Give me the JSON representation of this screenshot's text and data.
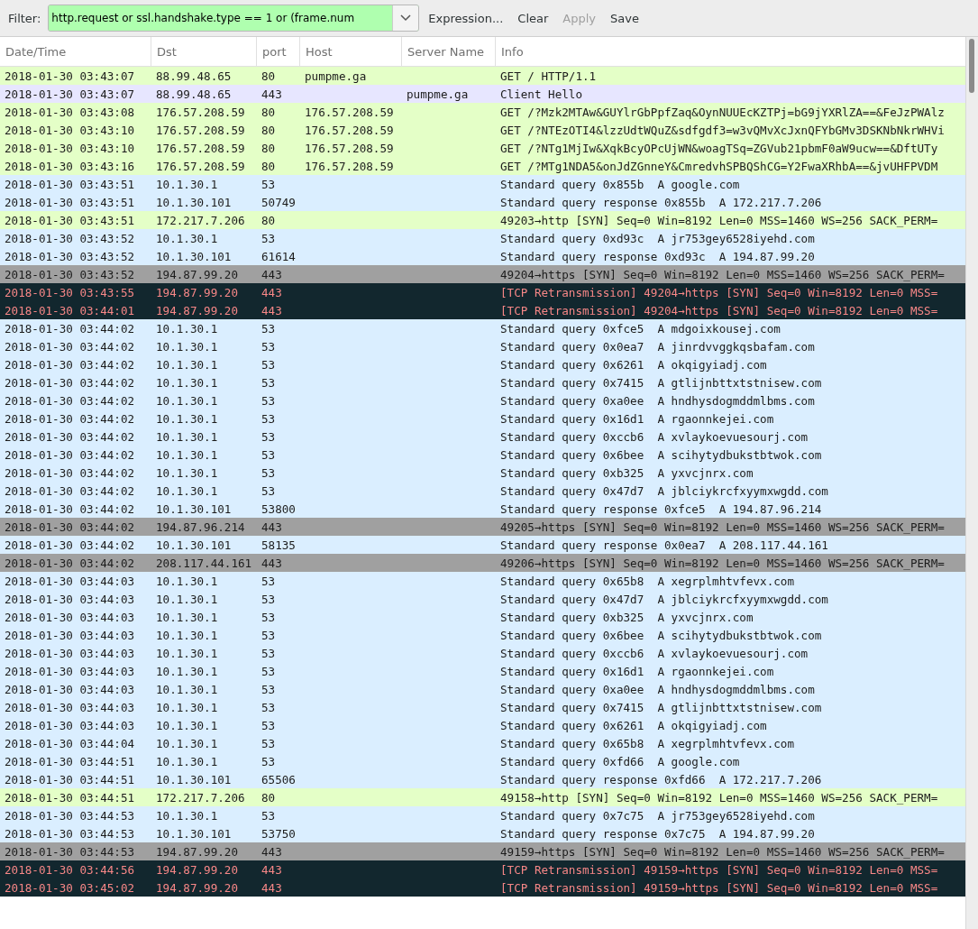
{
  "filter": {
    "label": "Filter:",
    "value": "http.request or ssl.handshake.type == 1 or (frame.num",
    "buttons": [
      {
        "label": "Expression...",
        "disabled": false
      },
      {
        "label": "Clear",
        "disabled": false
      },
      {
        "label": "Apply",
        "disabled": true
      },
      {
        "label": "Save",
        "disabled": false
      }
    ]
  },
  "table": {
    "columns": [
      "Date/Time",
      "Dst",
      "port",
      "Host",
      "Server Name",
      "Info"
    ],
    "rows": [
      {
        "kind": "http",
        "time": "2018-01-30 03:43:07",
        "dst": "88.99.48.65",
        "port": "80",
        "host": "pumpme.ga",
        "info": "GET / HTTP/1.1"
      },
      {
        "kind": "tls",
        "time": "2018-01-30 03:43:07",
        "dst": "88.99.48.65",
        "port": "443",
        "server": "pumpme.ga",
        "info": "Client Hello"
      },
      {
        "kind": "http",
        "time": "2018-01-30 03:43:08",
        "dst": "176.57.208.59",
        "port": "80",
        "host": "176.57.208.59",
        "info": "GET /?Mzk2MTAw&GUYlrGbPpfZaq&OynNUUEcKZTPj=bG9jYXRlZA==&FeJzPWAlz"
      },
      {
        "kind": "http",
        "time": "2018-01-30 03:43:10",
        "dst": "176.57.208.59",
        "port": "80",
        "host": "176.57.208.59",
        "info": "GET /?NTEzOTI4&lzzUdtWQuZ&sdfgdf3=w3vQMvXcJxnQFYbGMv3DSKNbNkrWHVi"
      },
      {
        "kind": "http",
        "time": "2018-01-30 03:43:10",
        "dst": "176.57.208.59",
        "port": "80",
        "host": "176.57.208.59",
        "info": "GET /?NTg1MjIw&XqkBcyOPcUjWN&woagTSq=ZGVub21pbmF0aW9ucw==&DftUTy"
      },
      {
        "kind": "http",
        "time": "2018-01-30 03:43:16",
        "dst": "176.57.208.59",
        "port": "80",
        "host": "176.57.208.59",
        "info": "GET /?MTg1NDA5&onJdZGnneY&CmredvhSPBQShCG=Y2FwaXRhbA==&jvUHFPVDM"
      },
      {
        "kind": "dns",
        "time": "2018-01-30 03:43:51",
        "dst": "10.1.30.1",
        "port": "53",
        "info": "Standard query 0x855b  A google.com"
      },
      {
        "kind": "dns",
        "time": "2018-01-30 03:43:51",
        "dst": "10.1.30.101",
        "port": "50749",
        "info": "Standard query response 0x855b  A 172.217.7.206"
      },
      {
        "kind": "http",
        "time": "2018-01-30 03:43:51",
        "dst": "172.217.7.206",
        "port": "80",
        "info": "49203→http [SYN] Seq=0 Win=8192 Len=0 MSS=1460 WS=256 SACK_PERM="
      },
      {
        "kind": "dns",
        "time": "2018-01-30 03:43:52",
        "dst": "10.1.30.1",
        "port": "53",
        "info": "Standard query 0xd93c  A jr753gey6528iyehd.com"
      },
      {
        "kind": "dns",
        "time": "2018-01-30 03:43:52",
        "dst": "10.1.30.101",
        "port": "61614",
        "info": "Standard query response 0xd93c  A 194.87.99.20"
      },
      {
        "kind": "syn",
        "time": "2018-01-30 03:43:52",
        "dst": "194.87.99.20",
        "port": "443",
        "info": "49204→https [SYN] Seq=0 Win=8192 Len=0 MSS=1460 WS=256 SACK_PERM="
      },
      {
        "kind": "retrans",
        "time": "2018-01-30 03:43:55",
        "dst": "194.87.99.20",
        "port": "443",
        "info": "[TCP Retransmission] 49204→https [SYN] Seq=0 Win=8192 Len=0 MSS="
      },
      {
        "kind": "retrans",
        "time": "2018-01-30 03:44:01",
        "dst": "194.87.99.20",
        "port": "443",
        "info": "[TCP Retransmission] 49204→https [SYN] Seq=0 Win=8192 Len=0 MSS="
      },
      {
        "kind": "dns",
        "time": "2018-01-30 03:44:02",
        "dst": "10.1.30.1",
        "port": "53",
        "info": "Standard query 0xfce5  A mdgoixkousej.com"
      },
      {
        "kind": "dns",
        "time": "2018-01-30 03:44:02",
        "dst": "10.1.30.1",
        "port": "53",
        "info": "Standard query 0x0ea7  A jinrdvvggkqsbafam.com"
      },
      {
        "kind": "dns",
        "time": "2018-01-30 03:44:02",
        "dst": "10.1.30.1",
        "port": "53",
        "info": "Standard query 0x6261  A okqigyiadj.com"
      },
      {
        "kind": "dns",
        "time": "2018-01-30 03:44:02",
        "dst": "10.1.30.1",
        "port": "53",
        "info": "Standard query 0x7415  A gtlijnbttxtstnisew.com"
      },
      {
        "kind": "dns",
        "time": "2018-01-30 03:44:02",
        "dst": "10.1.30.1",
        "port": "53",
        "info": "Standard query 0xa0ee  A hndhysdogmddmlbms.com"
      },
      {
        "kind": "dns",
        "time": "2018-01-30 03:44:02",
        "dst": "10.1.30.1",
        "port": "53",
        "info": "Standard query 0x16d1  A rgaonnkejei.com"
      },
      {
        "kind": "dns",
        "time": "2018-01-30 03:44:02",
        "dst": "10.1.30.1",
        "port": "53",
        "info": "Standard query 0xccb6  A xvlaykoevuesourj.com"
      },
      {
        "kind": "dns",
        "time": "2018-01-30 03:44:02",
        "dst": "10.1.30.1",
        "port": "53",
        "info": "Standard query 0x6bee  A scihytydbukstbtwok.com"
      },
      {
        "kind": "dns",
        "time": "2018-01-30 03:44:02",
        "dst": "10.1.30.1",
        "port": "53",
        "info": "Standard query 0xb325  A yxvcjnrx.com"
      },
      {
        "kind": "dns",
        "time": "2018-01-30 03:44:02",
        "dst": "10.1.30.1",
        "port": "53",
        "info": "Standard query 0x47d7  A jblciykrcfxyymxwgdd.com"
      },
      {
        "kind": "dns",
        "time": "2018-01-30 03:44:02",
        "dst": "10.1.30.101",
        "port": "53800",
        "info": "Standard query response 0xfce5  A 194.87.96.214"
      },
      {
        "kind": "syn",
        "time": "2018-01-30 03:44:02",
        "dst": "194.87.96.214",
        "port": "443",
        "info": "49205→https [SYN] Seq=0 Win=8192 Len=0 MSS=1460 WS=256 SACK_PERM="
      },
      {
        "kind": "dns",
        "time": "2018-01-30 03:44:02",
        "dst": "10.1.30.101",
        "port": "58135",
        "info": "Standard query response 0x0ea7  A 208.117.44.161"
      },
      {
        "kind": "syn",
        "time": "2018-01-30 03:44:02",
        "dst": "208.117.44.161",
        "port": "443",
        "info": "49206→https [SYN] Seq=0 Win=8192 Len=0 MSS=1460 WS=256 SACK_PERM="
      },
      {
        "kind": "dns",
        "time": "2018-01-30 03:44:03",
        "dst": "10.1.30.1",
        "port": "53",
        "info": "Standard query 0x65b8  A xegrplmhtvfevx.com"
      },
      {
        "kind": "dns",
        "time": "2018-01-30 03:44:03",
        "dst": "10.1.30.1",
        "port": "53",
        "info": "Standard query 0x47d7  A jblciykrcfxyymxwgdd.com"
      },
      {
        "kind": "dns",
        "time": "2018-01-30 03:44:03",
        "dst": "10.1.30.1",
        "port": "53",
        "info": "Standard query 0xb325  A yxvcjnrx.com"
      },
      {
        "kind": "dns",
        "time": "2018-01-30 03:44:03",
        "dst": "10.1.30.1",
        "port": "53",
        "info": "Standard query 0x6bee  A scihytydbukstbtwok.com"
      },
      {
        "kind": "dns",
        "time": "2018-01-30 03:44:03",
        "dst": "10.1.30.1",
        "port": "53",
        "info": "Standard query 0xccb6  A xvlaykoevuesourj.com"
      },
      {
        "kind": "dns",
        "time": "2018-01-30 03:44:03",
        "dst": "10.1.30.1",
        "port": "53",
        "info": "Standard query 0x16d1  A rgaonnkejei.com"
      },
      {
        "kind": "dns",
        "time": "2018-01-30 03:44:03",
        "dst": "10.1.30.1",
        "port": "53",
        "info": "Standard query 0xa0ee  A hndhysdogmddmlbms.com"
      },
      {
        "kind": "dns",
        "time": "2018-01-30 03:44:03",
        "dst": "10.1.30.1",
        "port": "53",
        "info": "Standard query 0x7415  A gtlijnbttxtstnisew.com"
      },
      {
        "kind": "dns",
        "time": "2018-01-30 03:44:03",
        "dst": "10.1.30.1",
        "port": "53",
        "info": "Standard query 0x6261  A okqigyiadj.com"
      },
      {
        "kind": "dns",
        "time": "2018-01-30 03:44:04",
        "dst": "10.1.30.1",
        "port": "53",
        "info": "Standard query 0x65b8  A xegrplmhtvfevx.com"
      },
      {
        "kind": "dns",
        "time": "2018-01-30 03:44:51",
        "dst": "10.1.30.1",
        "port": "53",
        "info": "Standard query 0xfd66  A google.com"
      },
      {
        "kind": "dns",
        "time": "2018-01-30 03:44:51",
        "dst": "10.1.30.101",
        "port": "65506",
        "info": "Standard query response 0xfd66  A 172.217.7.206"
      },
      {
        "kind": "http",
        "time": "2018-01-30 03:44:51",
        "dst": "172.217.7.206",
        "port": "80",
        "info": "49158→http [SYN] Seq=0 Win=8192 Len=0 MSS=1460 WS=256 SACK_PERM="
      },
      {
        "kind": "dns",
        "time": "2018-01-30 03:44:53",
        "dst": "10.1.30.1",
        "port": "53",
        "info": "Standard query 0x7c75  A jr753gey6528iyehd.com"
      },
      {
        "kind": "dns",
        "time": "2018-01-30 03:44:53",
        "dst": "10.1.30.101",
        "port": "53750",
        "info": "Standard query response 0x7c75  A 194.87.99.20"
      },
      {
        "kind": "syn",
        "time": "2018-01-30 03:44:53",
        "dst": "194.87.99.20",
        "port": "443",
        "info": "49159→https [SYN] Seq=0 Win=8192 Len=0 MSS=1460 WS=256 SACK_PERM="
      },
      {
        "kind": "retrans",
        "time": "2018-01-30 03:44:56",
        "dst": "194.87.99.20",
        "port": "443",
        "info": "[TCP Retransmission] 49159→https [SYN] Seq=0 Win=8192 Len=0 MSS="
      },
      {
        "kind": "retrans",
        "time": "2018-01-30 03:45:02",
        "dst": "194.87.99.20",
        "port": "443",
        "info": "[TCP Retransmission] 49159→https [SYN] Seq=0 Win=8192 Len=0 MSS="
      }
    ]
  }
}
